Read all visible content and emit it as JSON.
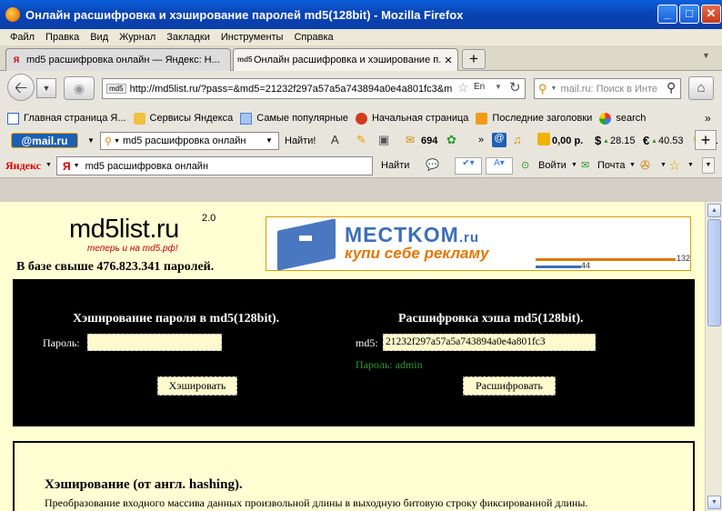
{
  "window": {
    "title": "Онлайн расшифровка и хэширование паролей md5(128bit) - Mozilla Firefox"
  },
  "menu": [
    "Файл",
    "Правка",
    "Вид",
    "Журнал",
    "Закладки",
    "Инструменты",
    "Справка"
  ],
  "tabs": [
    {
      "label": "md5 расшифровка онлайн — Яндекс: Н...",
      "icon": "Я"
    },
    {
      "label": "Онлайн расшифровка и хэширование п...",
      "icon": "md5"
    }
  ],
  "nav": {
    "url": "http://md5list.ru/?pass=&md5=21232f297a57a5a743894a0e4a801fc3&m",
    "url_site_badge": "md5",
    "search_placeholder": "mail.ru: Поиск в Инте"
  },
  "bookmarks": [
    {
      "label": "Главная страница Я...",
      "icon": "page-icon",
      "color": "#2a6ad1"
    },
    {
      "label": "Сервисы Яндекса",
      "icon": "folder-icon",
      "color": "#f0c040"
    },
    {
      "label": "Самые популярные",
      "icon": "search-icon",
      "color": "#4f84d6"
    },
    {
      "label": "Начальная страница",
      "icon": "firefox-icon",
      "color": "#d23b1e"
    },
    {
      "label": "Последние заголовки",
      "icon": "rss-icon",
      "color": "#f39a1a"
    },
    {
      "label": "search",
      "icon": "google-icon",
      "color": "#3a7ee0"
    }
  ],
  "bookmarks_more": "»",
  "mailbar": {
    "logo": "@mail.ru",
    "search_value": "md5 расшифровка онлайн",
    "find_label": "Найти!",
    "mail_count": "694",
    "more": "»",
    "balance": "0,00 р.",
    "usd": "28.15",
    "eur": "40.53",
    "weather": "+1"
  },
  "yandexbar": {
    "logo": "Яндекс",
    "search_value": "md5 расшифровка онлайн",
    "find_label": "Найти",
    "login_label": "Войти",
    "mail_label": "Почта"
  },
  "page": {
    "logo_main": "md5list.ru",
    "logo_version": "2.0",
    "logo_sub": "теперь и на md5.рф!",
    "count_text": "В базе свыше 476.823.341 паролей.",
    "banner": {
      "brand": "MECTKOM",
      "brand_suffix": ".ru",
      "slogan": "купи себе рекламу",
      "stat1": "132",
      "stat2": "44"
    },
    "hash_section": {
      "title": "Хэширование пароля в md5(128bit).",
      "label": "Пароль:",
      "value": "",
      "button": "Хэшировать"
    },
    "decrypt_section": {
      "title": "Расшифровка хэша md5(128bit).",
      "label": "md5:",
      "value": "21232f297a57a5a743894a0e4a801fc3",
      "result": "Пароль: admin",
      "button": "Расшифровать"
    },
    "article": {
      "heading": "Хэширование (от англ. hashing).",
      "text": "Преобразование входного массива данных произвольной длины в выходную битовую строку фиксированной длины."
    }
  },
  "colors": {
    "result_green": "#2f9a2f",
    "panel_bg": "#000000",
    "content_bg": "#ffffd4",
    "field_bg": "#fffacd"
  }
}
